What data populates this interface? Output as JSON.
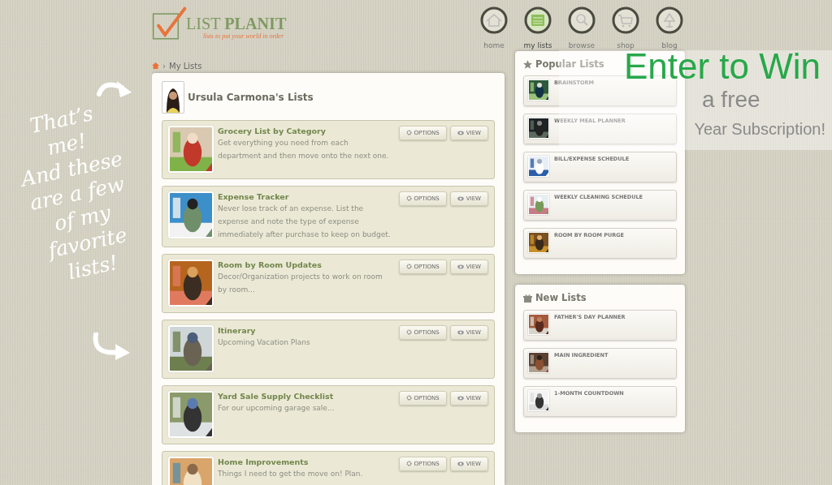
{
  "logo": {
    "word_light": "LIST",
    "word_bold": "PLANIT",
    "tagline": "lists to put your world in order"
  },
  "nav": [
    {
      "label": "home",
      "selected": false
    },
    {
      "label": "my lists",
      "selected": true
    },
    {
      "label": "browse",
      "selected": false
    },
    {
      "label": "shop",
      "selected": false
    },
    {
      "label": "blog",
      "selected": false
    }
  ],
  "breadcrumb": {
    "separator": "›",
    "current": "My Lists"
  },
  "profile": {
    "title": "Ursula Carmona's Lists"
  },
  "lists": [
    {
      "title": "Grocery List by Category",
      "description": "Get everything you need from each department and then move onto the next one.",
      "options": "OPTIONS",
      "view": "VIEW"
    },
    {
      "title": "Expense Tracker",
      "description": "Never lose track of an expense.  List the expense and note the type of expense immediately after purchase to keep on budget.",
      "options": "OPTIONS",
      "view": "VIEW"
    },
    {
      "title": "Room by Room Updates",
      "description": "Decor/Organization projects to work on room by room...",
      "options": "OPTIONS",
      "view": "VIEW"
    },
    {
      "title": "Itinerary",
      "description": "Upcoming Vacation Plans",
      "options": "OPTIONS",
      "view": "VIEW"
    },
    {
      "title": "Yard Sale Supply Checklist",
      "description": "For our upcoming garage sale...",
      "options": "OPTIONS",
      "view": "VIEW"
    },
    {
      "title": "Home Improvements",
      "description": "Things I need to get the move on! Plan.",
      "options": "OPTIONS",
      "view": "VIEW"
    }
  ],
  "popular_lists": {
    "title": "Popular Lists",
    "items": [
      {
        "title": "BRAINSTORM"
      },
      {
        "title": "WEEKLY MEAL PLANNER"
      },
      {
        "title": "BILL/EXPENSE SCHEDULE"
      },
      {
        "title": "WEEKLY CLEANING SCHEDULE"
      },
      {
        "title": "ROOM BY ROOM PURGE"
      }
    ]
  },
  "new_lists": {
    "title": "New Lists",
    "items": [
      {
        "title": "FATHER'S DAY PLANNER"
      },
      {
        "title": "MAIN INGREDIENT"
      },
      {
        "title": "1-MONTH COUNTDOWN"
      }
    ]
  },
  "promo": {
    "headline": "Enter to Win",
    "line_2": "a free",
    "line_3": "Year Subscription!"
  },
  "annotation": {
    "lines": [
      "That’s",
      "me!",
      "And these",
      "are a few",
      "of my",
      "favorite",
      "lists!"
    ]
  }
}
